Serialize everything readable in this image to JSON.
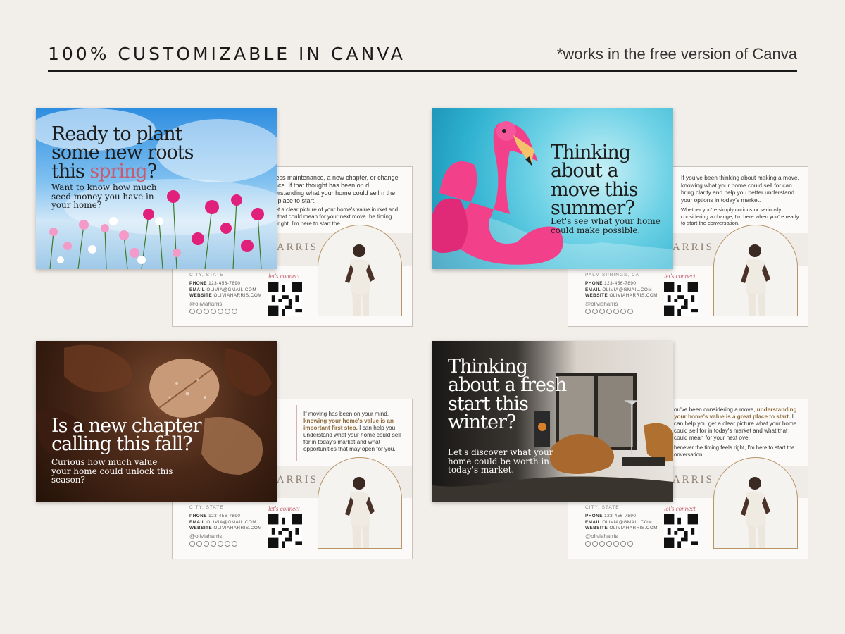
{
  "header": {
    "title": "100% CUSTOMIZABLE IN CANVA",
    "note": "*works in the free version of Canva"
  },
  "card_common": {
    "name": "HARRIS",
    "city_state": "CITY, STATE",
    "city_palm": "PALM SPRINGS, CA",
    "phone_label": "PHONE",
    "phone": "123-456-7890",
    "email_label": "EMAIL",
    "email": "OLIVIA@GMAIL.COM",
    "website_label": "WEBSITE",
    "website": "OLIVIAHARRIS.COM",
    "handle": "@oliviaharris",
    "connect": "let's connect"
  },
  "spring": {
    "headline_1": "Ready to plant",
    "headline_2": "some new roots",
    "headline_3a": "this ",
    "headline_3b": "spring",
    "headline_3c": "?",
    "sub": "Want to know how much seed money you have in your home?",
    "back_text_1": "ce, less maintenance, a new chapter, or change of pace. If that thought has been on d, understanding what your home could sell n the best place to start.",
    "back_text_2": "ou get a clear picture of your home's value in rket and what that could mean for your next move. he timing feels right, I'm here to start the"
  },
  "summer": {
    "headline": "Thinking about a move this summer?",
    "sub": "Let's see what your home could make possible.",
    "back_text_1": "If you've been thinking about making a move, knowing what your home could sell for can bring clarity and help you better understand your options in today's market.",
    "back_text_2": "Whether you're simply curious or seriously considering a change, I'm here when you're ready to start the conversation."
  },
  "fall": {
    "headline": "Is a new chapter calling this fall?",
    "sub": "Curious how much value your home could unlock this season?",
    "back_text_a": "If moving has been on your mind, ",
    "back_text_b": "knowing your home's value is an important first step.",
    "back_text_c": " I can help you understand what your home could sell for in today's market and what opportunities that may open for you."
  },
  "winter": {
    "headline": "Thinking about a fresh start this winter?",
    "sub": "Let's discover what your home could be worth in today's market.",
    "back_text_a": "ou've been considering a move, ",
    "back_text_b": "understanding your home's value is a great place to start.",
    "back_text_c": " I can help you get a clear picture what your home could sell for in today's market and what that could mean for your next ove.",
    "back_text_d": "henever the timing feels right, I'm here to start the onversation."
  },
  "colors": {
    "background": "#f2eeea",
    "accent_pink": "#c85a6e",
    "accent_gold": "#8a6a3a"
  }
}
